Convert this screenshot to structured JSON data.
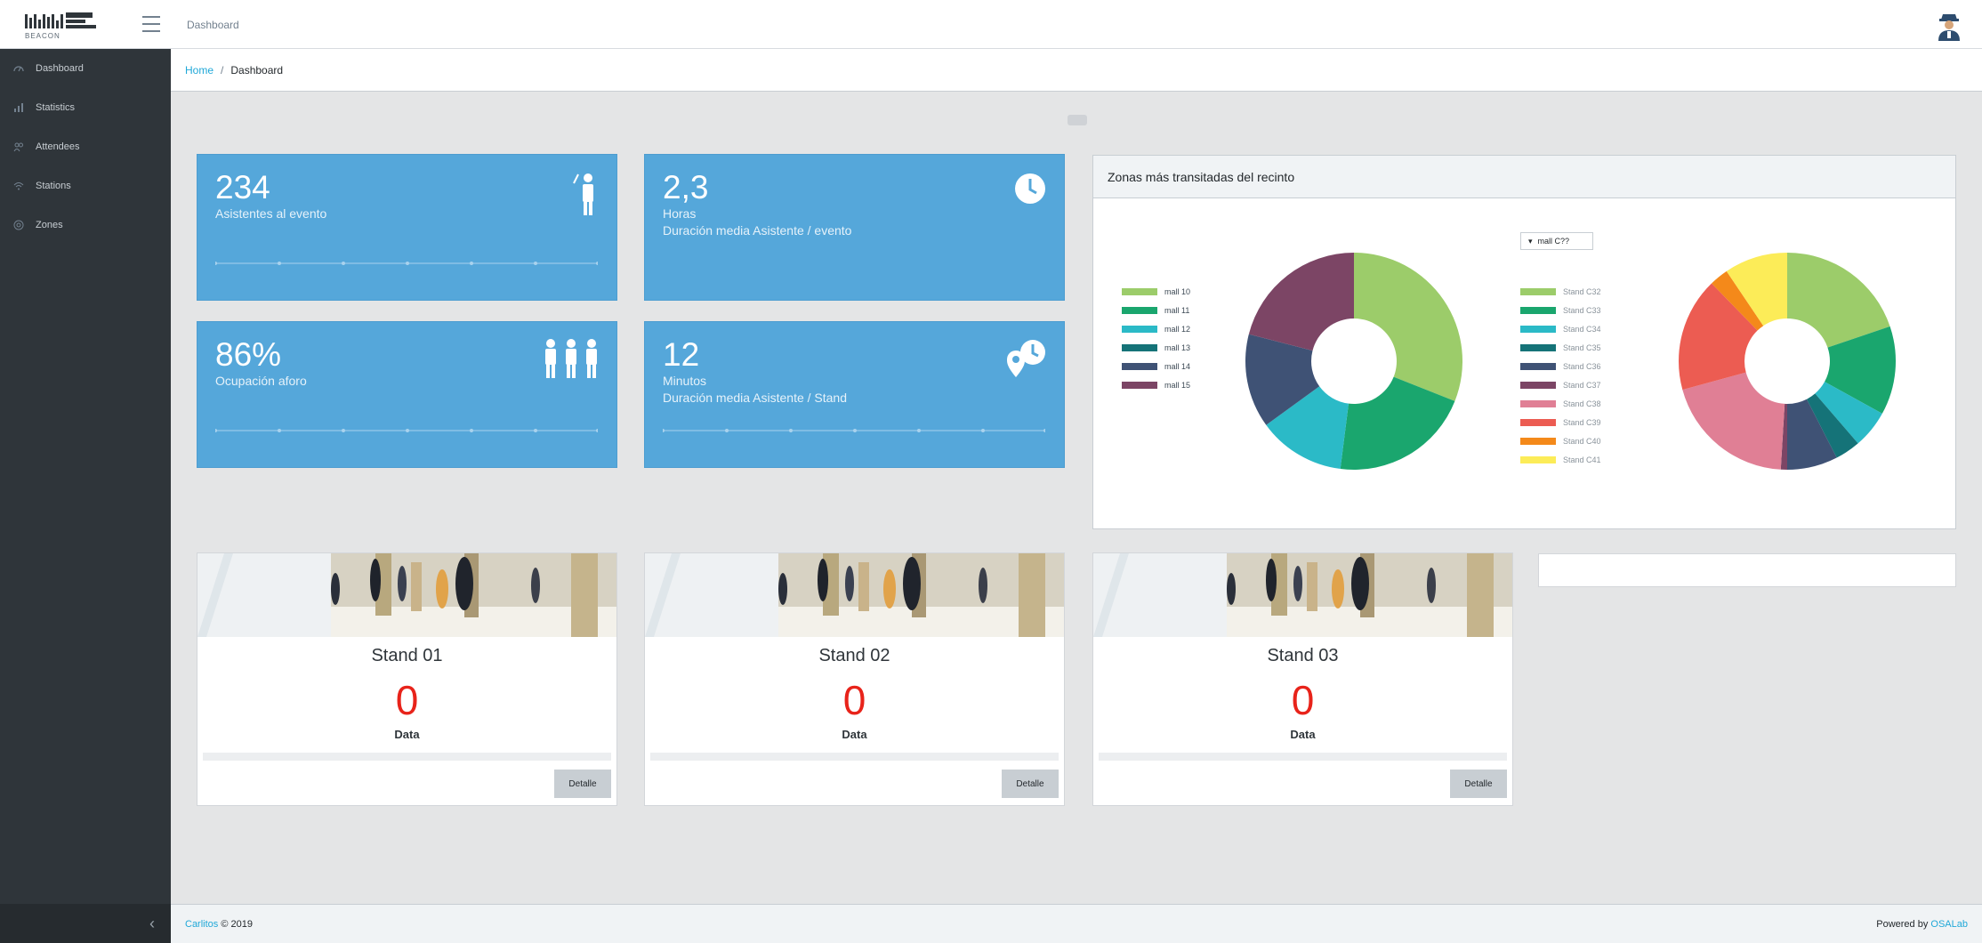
{
  "header": {
    "page_title": "Dashboard",
    "logo_sub": "BEACON"
  },
  "breadcrumb": {
    "home": "Home",
    "separator": "/",
    "current": "Dashboard"
  },
  "sidebar": {
    "items": [
      {
        "label": "Dashboard",
        "icon": "speedometer-icon"
      },
      {
        "label": "Statistics",
        "icon": "chart-icon"
      },
      {
        "label": "Attendees",
        "icon": "people-icon"
      },
      {
        "label": "Stations",
        "icon": "wifi-icon"
      },
      {
        "label": "Zones",
        "icon": "target-icon"
      }
    ],
    "minimize_glyph": "‹"
  },
  "stats": [
    {
      "value": "234",
      "line1": "Asistentes al evento",
      "line2": "",
      "icon": "person-icon"
    },
    {
      "value": "2,3",
      "line1": "Horas",
      "line2": "Duración media Asistente / evento",
      "icon": "clock-icon"
    },
    {
      "value": "86%",
      "line1": "Ocupación aforo",
      "line2": "",
      "icon": "group-icon"
    },
    {
      "value": "12",
      "line1": "Minutos",
      "line2": "Duración media Asistente / Stand",
      "icon": "location-clock-icon"
    }
  ],
  "zones_panel": {
    "title": "Zonas más transitadas del recinto",
    "filter_label": "mall C?? ",
    "chart_data": [
      {
        "type": "pie",
        "categories": [
          "mall 10",
          "mall 11",
          "mall 12",
          "mall 13",
          "mall 14",
          "mall 15"
        ],
        "values": [
          31,
          21,
          13,
          0,
          14,
          21
        ],
        "colors": [
          "#9ccc6a",
          "#1aa66e",
          "#2bbac7",
          "#157378",
          "#3f5275",
          "#7c4565"
        ]
      },
      {
        "type": "pie",
        "categories": [
          "Stand C32",
          "Stand C33",
          "Stand C34",
          "Stand C35",
          "Stand C36",
          "Stand C37",
          "Stand C38",
          "Stand C39",
          "Stand C40",
          "Stand C41"
        ],
        "values": [
          21,
          14,
          6,
          4,
          8,
          1,
          21,
          18,
          3,
          10
        ],
        "colors": [
          "#9ccc6a",
          "#1aa66e",
          "#2bbac7",
          "#157378",
          "#3f5275",
          "#7c4565",
          "#e07f95",
          "#ec5c52",
          "#f4891a",
          "#fcec58"
        ]
      }
    ]
  },
  "stands": [
    {
      "name": "Stand 01",
      "count": "0",
      "data_label": "Data",
      "button": "Detalle"
    },
    {
      "name": "Stand 02",
      "count": "0",
      "data_label": "Data",
      "button": "Detalle"
    },
    {
      "name": "Stand 03",
      "count": "0",
      "data_label": "Data",
      "button": "Detalle"
    }
  ],
  "footer": {
    "brand": "Carlitos",
    "copyright": "© 2019",
    "powered_by": "Powered by",
    "powered_link": "OSALab"
  },
  "colors": {
    "stat_blue": "#55a7da",
    "sidebar": "#2f353a",
    "count_red": "#e8231a",
    "link": "#20a8d8"
  }
}
